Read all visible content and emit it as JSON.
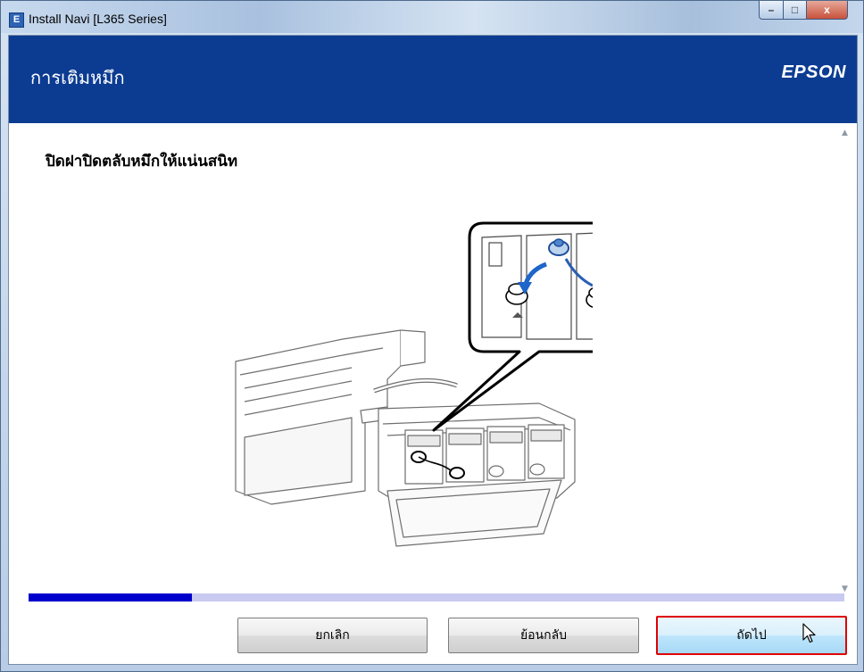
{
  "window": {
    "title": "Install Navi [L365 Series]",
    "app_icon_letter": "E",
    "min_glyph": "–",
    "max_glyph": "□",
    "close_glyph": "x"
  },
  "header": {
    "title": "การเติมหมึก",
    "brand": "EPSON",
    "band_color": "#0c3c92"
  },
  "content": {
    "instruction": "ปิดฝาปิดตลับหมึกให้แน่นสนิท",
    "illustration_icon": "printer-ink-tank-cap-icon"
  },
  "progress": {
    "value": 0.2,
    "fill_color": "#0000cc",
    "track_color": "#c9caf2"
  },
  "buttons": {
    "cancel": "ยกเลิก",
    "back": "ย้อนกลับ",
    "next": "ถัดไป",
    "highlight_color": "#e00000"
  }
}
